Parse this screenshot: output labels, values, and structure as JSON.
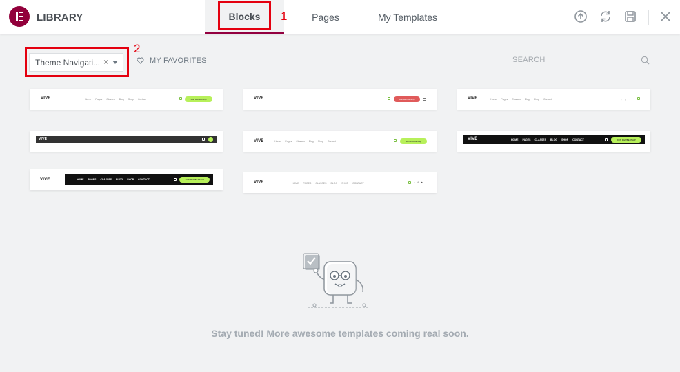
{
  "header": {
    "title": "LIBRARY",
    "tabs": [
      {
        "label": "Blocks",
        "active": true
      },
      {
        "label": "Pages",
        "active": false
      },
      {
        "label": "My Templates",
        "active": false
      }
    ],
    "icons": [
      "upload-icon",
      "sync-icon",
      "save-icon",
      "close-icon"
    ]
  },
  "annotations": {
    "one": "1",
    "two": "2",
    "color": "#e4000f"
  },
  "toolbar": {
    "filter_value": "Theme Navigati...",
    "clear_symbol": "×",
    "favorites_label": "MY FAVORITES",
    "search_placeholder": "SEARCH"
  },
  "templates": {
    "brand": "VIVE",
    "nav_links": [
      "Home",
      "Pages",
      "Classes",
      "Blog",
      "Shop",
      "Contact"
    ],
    "nav_links_caps": [
      "HOME",
      "PAGES",
      "CLASSES",
      "BLOG",
      "SHOP",
      "CONTACT"
    ],
    "cta": "Join Membership",
    "cta_caps": "JOIN MEMBERSHIP"
  },
  "empty_state": {
    "message": "Stay tuned! More awesome templates coming real soon."
  },
  "colors": {
    "brand": "#92003b",
    "accent_green": "#b7f05a",
    "accent_red": "#e05a5a"
  }
}
